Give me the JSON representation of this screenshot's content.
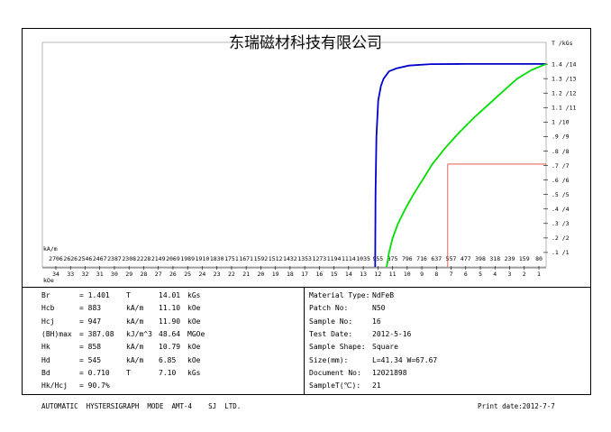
{
  "header": {
    "title": "东瑞磁材科技有限公司"
  },
  "chart_data": {
    "type": "line",
    "y_unit_label": "T /kGs",
    "x_unit_label_upper": "kA/m",
    "x_unit_label_lower": "kOe",
    "y_ticks": [
      {
        "value": 0.1,
        "label": ".1 /1"
      },
      {
        "value": 0.2,
        "label": ".2 /2"
      },
      {
        "value": 0.3,
        "label": ".3 /3"
      },
      {
        "value": 0.4,
        "label": ".4 /4"
      },
      {
        "value": 0.5,
        "label": ".5 /5"
      },
      {
        "value": 0.6,
        "label": ".6 /6"
      },
      {
        "value": 0.7,
        "label": ".7 /7"
      },
      {
        "value": 0.8,
        "label": ".8 /8"
      },
      {
        "value": 0.9,
        "label": ".9 /9"
      },
      {
        "value": 1.0,
        "label": "1 /10"
      },
      {
        "value": 1.1,
        "label": "1.1 /11"
      },
      {
        "value": 1.2,
        "label": "1.2 /12"
      },
      {
        "value": 1.3,
        "label": "1.3 /13"
      },
      {
        "value": 1.4,
        "label": "1.4 /14"
      }
    ],
    "ylim": [
      0,
      1.55
    ],
    "xlim_kAm": [
      2790,
      0
    ],
    "x_ticks_kAm": [
      "2706",
      "2626",
      "2546",
      "2467",
      "2387",
      "2308",
      "2228",
      "2149",
      "2069",
      "1989",
      "1910",
      "1830",
      "1751",
      "1671",
      "1592",
      "1512",
      "1432",
      "1353",
      "1273",
      "1194",
      "1114",
      "1035",
      "955",
      "875",
      "796",
      "716",
      "637",
      "557",
      "477",
      "398",
      "318",
      "239",
      "159",
      "80"
    ],
    "x_ticks_kOe": [
      "34",
      "33",
      "32",
      "31",
      "30",
      "29",
      "28",
      "27",
      "26",
      "25",
      "24",
      "23",
      "22",
      "21",
      "20",
      "19",
      "18",
      "17",
      "16",
      "15",
      "14",
      "13",
      "12",
      "11",
      "10",
      "9",
      "8",
      "7",
      "6",
      "5",
      "4",
      "3",
      "2",
      "1"
    ],
    "series": [
      {
        "color": "#0000cc",
        "points": [
          [
            947,
            0.0
          ],
          [
            945,
            0.5
          ],
          [
            940,
            0.9
          ],
          [
            930,
            1.15
          ],
          [
            915,
            1.25
          ],
          [
            900,
            1.3
          ],
          [
            870,
            1.35
          ],
          [
            830,
            1.37
          ],
          [
            760,
            1.39
          ],
          [
            640,
            1.4
          ],
          [
            450,
            1.401
          ],
          [
            200,
            1.401
          ],
          [
            0,
            1.401
          ]
        ]
      },
      {
        "color": "#00dd00",
        "points": [
          [
            883,
            0.0
          ],
          [
            870,
            0.1
          ],
          [
            850,
            0.2
          ],
          [
            820,
            0.3
          ],
          [
            780,
            0.4
          ],
          [
            735,
            0.5
          ],
          [
            685,
            0.6
          ],
          [
            630,
            0.71
          ],
          [
            560,
            0.82
          ],
          [
            480,
            0.93
          ],
          [
            400,
            1.03
          ],
          [
            320,
            1.12
          ],
          [
            240,
            1.21
          ],
          [
            160,
            1.3
          ],
          [
            80,
            1.36
          ],
          [
            0,
            1.401
          ]
        ]
      }
    ],
    "working_point": {
      "H_kAm": 545,
      "B_T": 0.71,
      "color": "#dd4433"
    }
  },
  "params_left": [
    {
      "label": "Br",
      "value": "= 1.401",
      "unit": "T",
      "value2": "14.01",
      "unit2": "kGs"
    },
    {
      "label": "Hcb",
      "value": "= 883",
      "unit": "kA/m",
      "value2": "11.10",
      "unit2": "kOe"
    },
    {
      "label": "Hcj",
      "value": "= 947",
      "unit": "kA/m",
      "value2": "11.90",
      "unit2": "kOe"
    },
    {
      "label": "(BH)max",
      "value": "= 387.08",
      "unit": "kJ/m^3",
      "value2": "48.64",
      "unit2": "MGOe"
    },
    {
      "label": "Hk",
      "value": "= 858",
      "unit": "kA/m",
      "value2": "10.79",
      "unit2": "kOe"
    },
    {
      "label": "Hd",
      "value": "= 545",
      "unit": "kA/m",
      "value2": "6.85",
      "unit2": "kOe"
    },
    {
      "label": "Bd",
      "value": "= 0.710",
      "unit": "T",
      "value2": "7.10",
      "unit2": "kGs"
    },
    {
      "label": "Hk/Hcj",
      "value": "= 90.7%",
      "unit": "",
      "value2": "",
      "unit2": ""
    }
  ],
  "params_right": [
    {
      "label": "Material Type:",
      "value": "NdFeB"
    },
    {
      "label": "Patch No:",
      "value": "N50"
    },
    {
      "label": "Sample No:",
      "value": "16"
    },
    {
      "label": "Test Date:",
      "value": "2012-5-16"
    },
    {
      "label": "Sample Shape:",
      "value": "Square"
    },
    {
      "label": "Size(mm):",
      "value": "L=41.34  W=67.67"
    },
    {
      "label": "Document No:",
      "value": "12021898"
    },
    {
      "label": "SampleT(℃):",
      "value": "21"
    }
  ],
  "footer": {
    "left": "AUTOMATIC  HYSTERSIGRAPH  MODE  AMT-4    SJ  LTD.",
    "right": "Print date:2012-7-7"
  }
}
